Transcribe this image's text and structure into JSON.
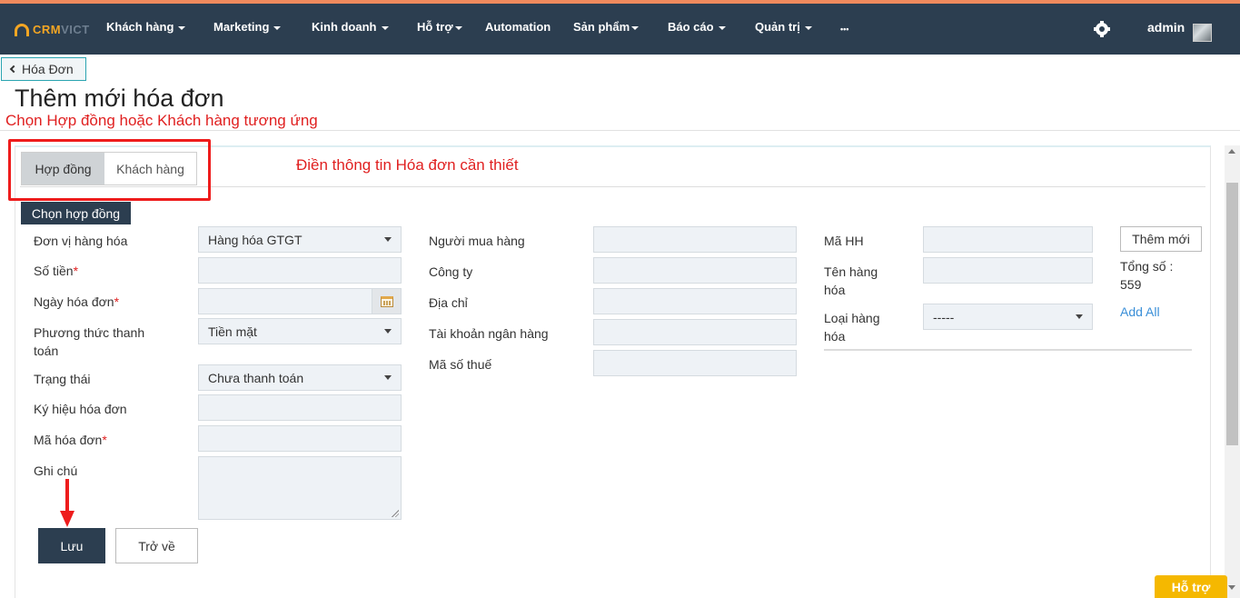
{
  "brand": {
    "logo_text_a": "CRM",
    "logo_text_b": "VICT"
  },
  "nav": {
    "items": [
      {
        "label": "Khách hàng"
      },
      {
        "label": "Marketing"
      },
      {
        "label": "Kinh doanh"
      },
      {
        "label": "Hỗ trợ"
      },
      {
        "label": "Automation"
      },
      {
        "label": "Sản phẩm"
      },
      {
        "label": "Báo cáo"
      },
      {
        "label": "Quản trị"
      },
      {
        "label": "•••"
      }
    ],
    "user": "admin",
    "settings_icon": "gear-icon"
  },
  "breadcrumb": {
    "back_label": "Hóa Đơn"
  },
  "page": {
    "title": "Thêm mới hóa đơn"
  },
  "annotations": {
    "select_hint": "Chọn Hợp đồng hoặc Khách hàng tương ứng",
    "fill_hint": "Điền thông tin Hóa đơn cần thiết"
  },
  "tabs": [
    {
      "label": "Hợp đồng",
      "active": true
    },
    {
      "label": "Khách hàng",
      "active": false
    }
  ],
  "choose_contract_label": "Chọn hợp đồng",
  "form_left": {
    "don_vi": {
      "label": "Đơn vị hàng hóa",
      "value": "Hàng hóa GTGT"
    },
    "so_tien": {
      "label": "Số tiền",
      "required_mark": "*",
      "value": ""
    },
    "ngay": {
      "label": "Ngày hóa đơn",
      "required_mark": "*",
      "value": ""
    },
    "phuong_thuc": {
      "label_line1": "Phương thức thanh",
      "label_line2": "toán",
      "value": "Tiền mặt"
    },
    "trang_thai": {
      "label": "Trạng thái",
      "value": "Chưa thanh toán"
    },
    "ky_hieu": {
      "label": "Ký hiệu hóa đơn",
      "value": ""
    },
    "ma_hoa_don": {
      "label": "Mã hóa đơn",
      "required_mark": "*",
      "value": ""
    },
    "ghi_chu": {
      "label": "Ghi chú",
      "value": ""
    }
  },
  "form_mid": {
    "nguoi_mua": {
      "label": "Người mua hàng",
      "value": ""
    },
    "cong_ty": {
      "label": "Công ty",
      "value": ""
    },
    "dia_chi": {
      "label": "Địa chỉ",
      "value": ""
    },
    "tai_khoan": {
      "label": "Tài khoản ngân hàng",
      "value": ""
    },
    "ma_so_thue": {
      "label": "Mã số thuế",
      "value": ""
    }
  },
  "form_right": {
    "ma_hh": {
      "label": "Mã HH",
      "value": ""
    },
    "ten_hh": {
      "label_line1": "Tên hàng",
      "label_line2": "hóa",
      "value": ""
    },
    "loai_hh": {
      "label_line1": "Loại hàng",
      "label_line2": "hóa",
      "value": "-----"
    },
    "add_new_label": "Thêm mới",
    "total_label": "Tổng số :",
    "total_value": "559",
    "add_all_label": "Add All"
  },
  "actions": {
    "save_label": "Lưu",
    "back_label": "Trở về"
  },
  "help_button": "Hỗ trợ",
  "colors": {
    "topbar": "#2c3e50",
    "accent": "#f5a623",
    "annotation_red": "#e02020",
    "help": "#f5b800"
  }
}
